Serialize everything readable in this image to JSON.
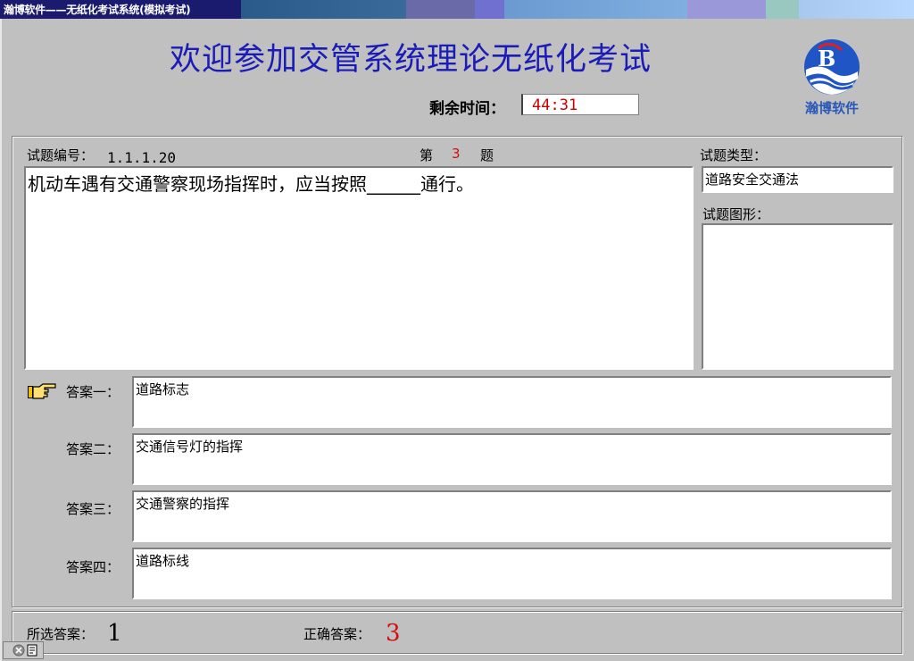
{
  "window": {
    "title": "瀚博软件——无纸化考试系统(模拟考试)"
  },
  "header": {
    "title": "欢迎参加交管系统理论无纸化考试",
    "time_label": "剩余时间：",
    "time_value": "44:31",
    "logo_text": "瀚博软件"
  },
  "question": {
    "id_label": "试题编号：",
    "id_value": "1.1.1.20",
    "num_prefix": "第",
    "num_value": "3",
    "num_suffix": "题",
    "text": "机动车遇有交通警察现场指挥时，应当按照______通行。",
    "type_label": "试题类型：",
    "type_value": "道路安全交通法",
    "figure_label": "试题图形："
  },
  "answers": [
    {
      "label": "答案一：",
      "text": "道路标志"
    },
    {
      "label": "答案二：",
      "text": "交通信号灯的指挥"
    },
    {
      "label": "答案三：",
      "text": "交通警察的指挥"
    },
    {
      "label": "答案四：",
      "text": "道路标线"
    }
  ],
  "status": {
    "selected_label": "所选答案：",
    "selected_value": "1",
    "correct_label": "正确答案：",
    "correct_value": "3"
  },
  "colors": {
    "title_blue": "#1b1bb8",
    "accent_red": "#d01010",
    "bg_gray": "#c0c0c0"
  },
  "icons": [
    "pointing-hand-icon",
    "logo-icon",
    "close-icon",
    "taskbar-icon"
  ]
}
